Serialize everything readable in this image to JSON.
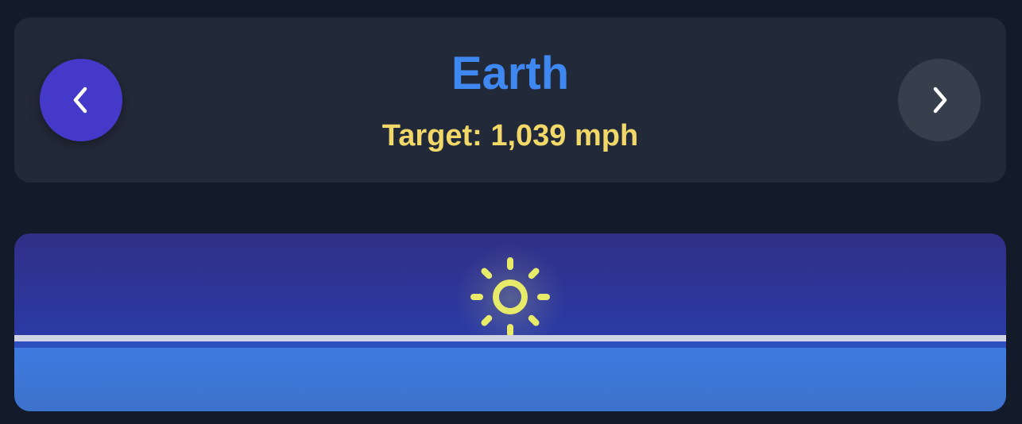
{
  "header": {
    "planet_name": "Earth",
    "target_label": "Target: 1,039 mph",
    "prev_icon": "chevron-left-icon",
    "next_icon": "chevron-right-icon"
  },
  "scene": {
    "sun_icon": "sun-icon"
  },
  "colors": {
    "background": "#131a29",
    "card": "#222938",
    "planet_name": "#3f88f2",
    "target_text": "#f2d868",
    "prev_button": "#4439c9",
    "next_button": "#383f4c",
    "sun": "#e8ea6a",
    "sky_top": "#312f86",
    "sky_bottom": "#2743b6",
    "ground": "#3e7be0"
  }
}
